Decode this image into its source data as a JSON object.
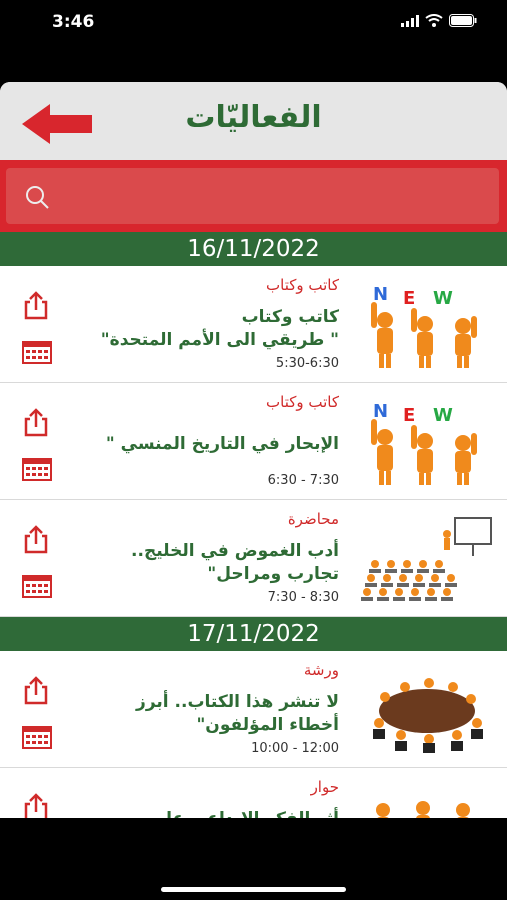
{
  "status_bar": {
    "time": "3:46"
  },
  "header": {
    "title": "الفعاليّات"
  },
  "search": {
    "placeholder": ""
  },
  "colors": {
    "accent_red": "#d8262d",
    "header_green": "#2e6b35",
    "date_band": "#2f6a38",
    "category_red": "#d02a2a"
  },
  "groups": [
    {
      "date": "16/11/2022",
      "events": [
        {
          "category": "كاتب وكتاب",
          "title": "كاتب وكتاب\n\" طريقي الى الأمم المتحدة\"",
          "time": "5:30-6:30",
          "image": "news-people-image"
        },
        {
          "category": "كاتب وكتاب",
          "title": "الإبحار في التاريخ المنسي \"",
          "time": "6:30 - 7:30",
          "image": "news-people-image"
        },
        {
          "category": "محاضرة",
          "title": "أدب الغموض في الخليج..\nتجارب ومراحل\"",
          "time": "7:30 - 8:30",
          "image": "lecture-image"
        }
      ]
    },
    {
      "date": "17/11/2022",
      "events": [
        {
          "category": "ورشة",
          "title": "لا تنشر هذا الكتاب.. أبرز\nأخطاء المؤلفون\"",
          "time": "10:00 - 12:00",
          "image": "round-table-image"
        },
        {
          "category": "حوار",
          "title": "أثر الفكر الإبداعي على",
          "time": "",
          "image": "people-image"
        }
      ]
    }
  ]
}
